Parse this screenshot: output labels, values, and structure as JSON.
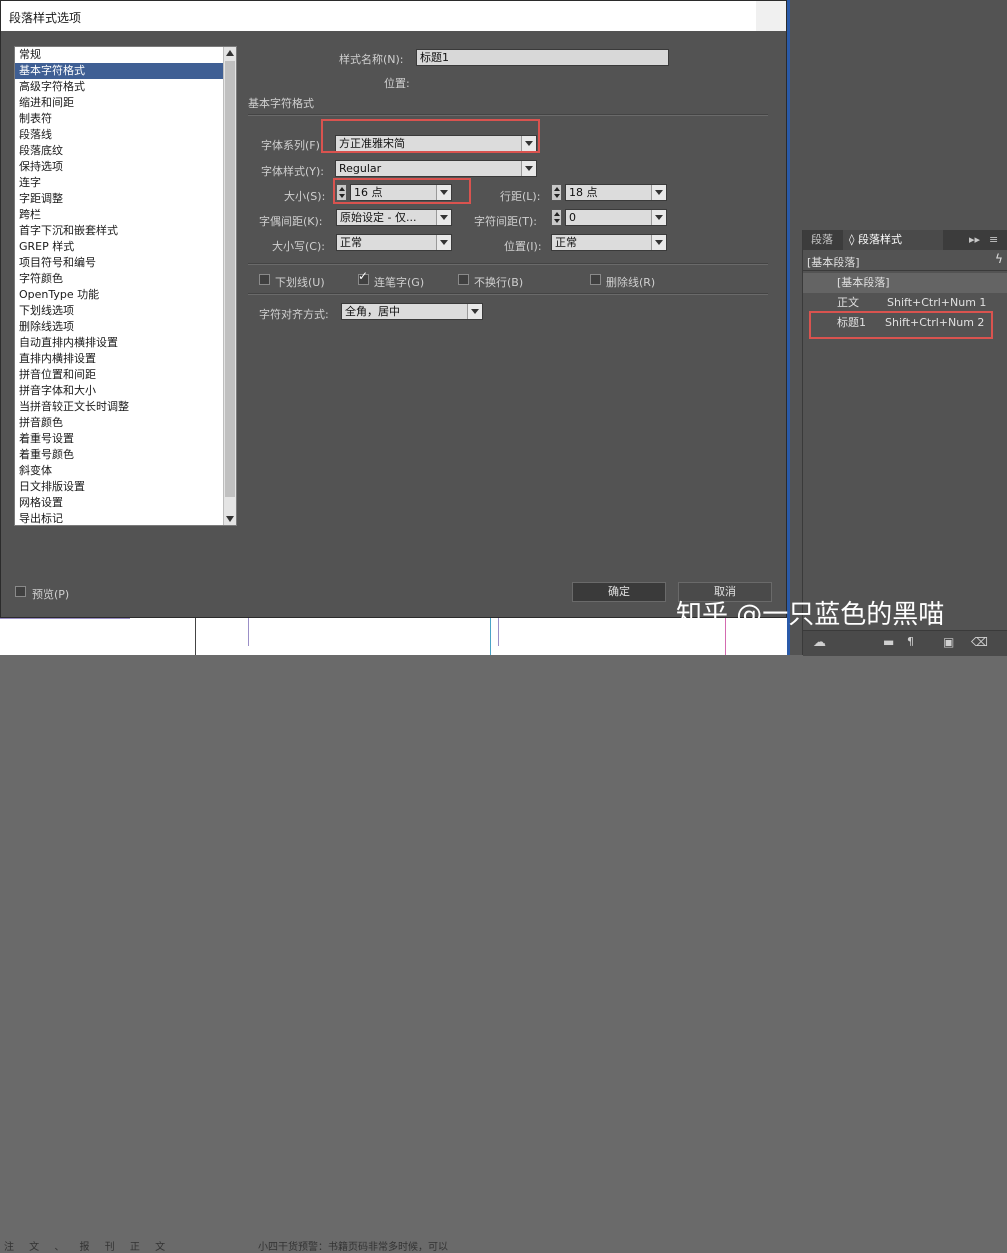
{
  "dialog": {
    "title": "段落样式选项",
    "categories": [
      "常规",
      "基本字符格式",
      "高级字符格式",
      "缩进和间距",
      "制表符",
      "段落线",
      "段落底纹",
      "保持选项",
      "连字",
      "字距调整",
      "跨栏",
      "首字下沉和嵌套样式",
      "GREP 样式",
      "项目符号和编号",
      "字符颜色",
      "OpenType 功能",
      "下划线选项",
      "删除线选项",
      "自动直排内横排设置",
      "直排内横排设置",
      "拼音位置和间距",
      "拼音字体和大小",
      "当拼音较正文长时调整",
      "拼音颜色",
      "着重号设置",
      "着重号颜色",
      "斜变体",
      "日文排版设置",
      "网格设置",
      "导出标记"
    ],
    "selected_index": 1,
    "style_name_label": "样式名称(N):",
    "style_name_value": "标题1",
    "location_label": "位置:",
    "section_title": "基本字符格式",
    "font_family_label": "字体系列(F):",
    "font_family_value": "方正准雅宋简",
    "font_style_label": "字体样式(Y):",
    "font_style_value": "Regular",
    "size_label": "大小(S):",
    "size_value": "16 点",
    "leading_label": "行距(L):",
    "leading_value": "18 点",
    "kerning_label": "字偶间距(K):",
    "kerning_value": "原始设定 - 仅...",
    "tracking_label": "字符间距(T):",
    "tracking_value": "0",
    "case_label": "大小写(C):",
    "case_value": "正常",
    "position_label": "位置(I):",
    "position_value": "正常",
    "underline_label": "下划线(U)",
    "underline_checked": false,
    "ligatures_label": "连笔字(G)",
    "ligatures_checked": true,
    "nobreak_label": "不换行(B)",
    "nobreak_checked": false,
    "strikethrough_label": "删除线(R)",
    "strikethrough_checked": false,
    "char_align_label": "字符对齐方式:",
    "char_align_value": "全角，居中",
    "preview_label": "预览(P)",
    "ok_label": "确定",
    "cancel_label": "取消"
  },
  "panel": {
    "tab1": "段落",
    "tab2": "段落样式",
    "current": "[基本段落]",
    "styles": [
      {
        "name": "[基本段落]",
        "shortcut": ""
      },
      {
        "name": "正文",
        "shortcut": "Shift+Ctrl+Num 1"
      },
      {
        "name": "标题1",
        "shortcut": "Shift+Ctrl+Num 2"
      }
    ]
  },
  "background": {
    "doc_text_left": "注 文 、 报 刊 正 文",
    "doc_text_mid": "小四干货预警：书籍页码非常多时候，可以"
  },
  "watermark": "知乎 @一只蓝色的黑喵",
  "colors": {
    "highlight": "#d9534f",
    "selection": "#3f5f94",
    "dialog_bg": "#535353"
  }
}
